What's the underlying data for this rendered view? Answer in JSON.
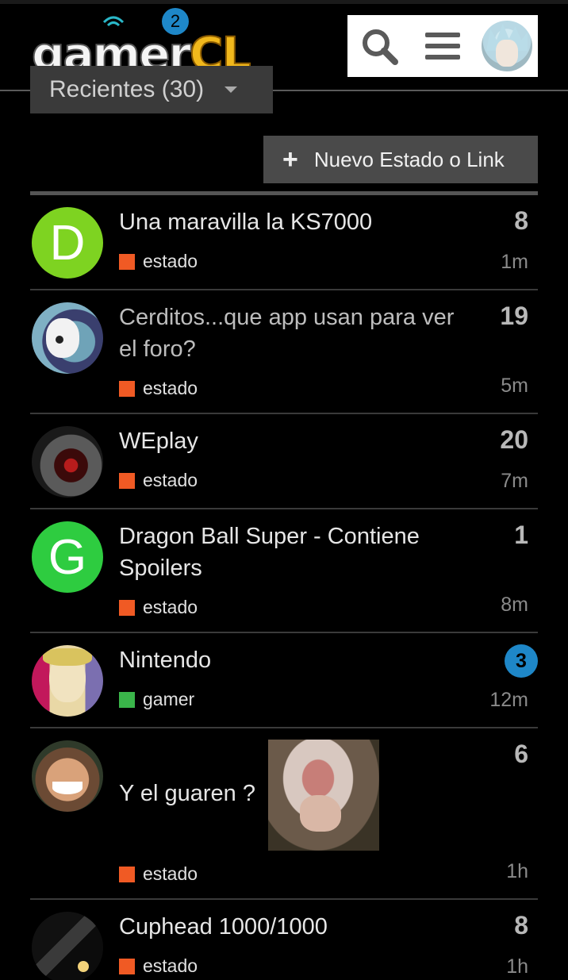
{
  "header": {
    "logo_text_a": "gamer",
    "logo_text_b": "CL",
    "notification_count": "2",
    "icons": {
      "search": "search-icon",
      "menu": "hamburger-icon",
      "avatar": "user-avatar"
    }
  },
  "filter": {
    "label": "Recientes (30)"
  },
  "new_topic_button": {
    "label": "Nuevo Estado o Link"
  },
  "colors": {
    "estado": "#f05a24",
    "gamer": "#3ab54a",
    "badge": "#1e87c8"
  },
  "topics": [
    {
      "title": "Una maravilla la KS7000",
      "category": "estado",
      "count": "8",
      "age": "1m",
      "avatar_letter": "D",
      "avatar_color": "#7ed321"
    },
    {
      "title": "Cerditos...que app usan para ver el foro?",
      "category": "estado",
      "count": "19",
      "age": "5m"
    },
    {
      "title": "WEplay",
      "category": "estado",
      "count": "20",
      "age": "7m"
    },
    {
      "title": "Dragon Ball Super - Contiene Spoilers",
      "category": "estado",
      "count": "1",
      "age": "8m",
      "avatar_letter": "G",
      "avatar_color": "#2ecc40"
    },
    {
      "title": "Nintendo",
      "category": "gamer",
      "count": "3",
      "age": "12m",
      "unread": true
    },
    {
      "title": "Y el guaren ?",
      "category": "estado",
      "count": "6",
      "age": "1h"
    },
    {
      "title": "Cuphead 1000/1000",
      "category": "estado",
      "count": "8",
      "age": "1h"
    }
  ]
}
